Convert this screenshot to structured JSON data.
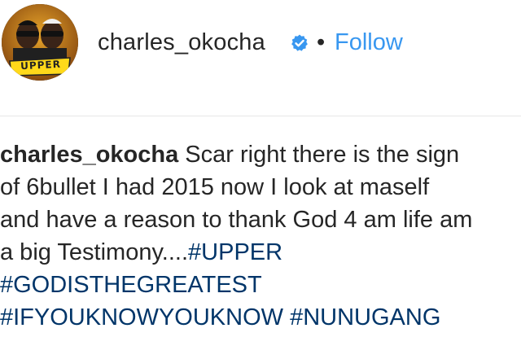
{
  "header": {
    "avatar_text": "UPPER",
    "username": "charles_okocha",
    "separator": "•",
    "follow_label": "Follow"
  },
  "caption": {
    "username": "charles_okocha",
    "line1_text": " Scar right there is the sign",
    "line2_text": "of 6bullet I had 2015 now I look at maself",
    "line3_text": "and have a reason to thank God 4 am life am",
    "line4_text": "a big Testimony....",
    "hashtags": [
      "#UPPER",
      "#GODISTHEGREATEST",
      "#IFYOUKNOWYOUKNOW",
      "#NUNUGANG"
    ],
    "space": " "
  },
  "colors": {
    "link_blue": "#3897f0",
    "hashtag_navy": "#003569",
    "text": "#262626",
    "verified_blue": "#3897f0"
  }
}
